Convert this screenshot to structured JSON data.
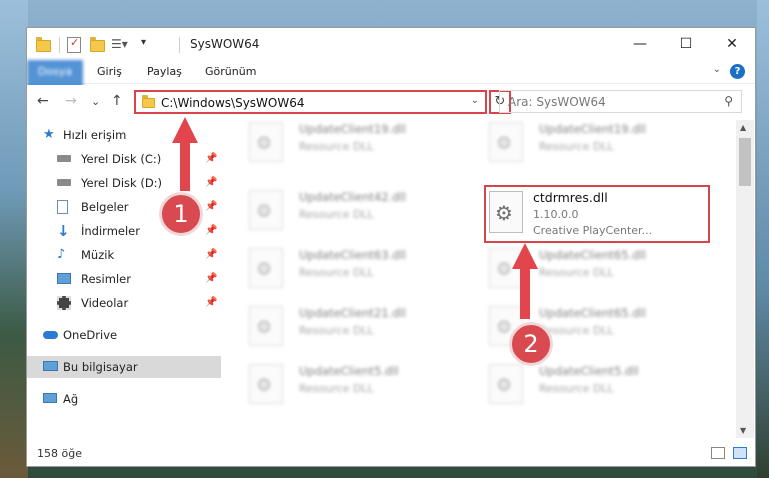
{
  "window": {
    "title": "SysWOW64",
    "minimize": "—",
    "maximize": "☐",
    "close": "✕"
  },
  "ribbon": {
    "tabs": [
      "Dosya",
      "Giriş",
      "Paylaş",
      "Görünüm"
    ],
    "help": "?"
  },
  "navbar": {
    "back": "←",
    "forward": "→",
    "recent": "⌄",
    "up": "↑",
    "address": "C:\\Windows\\SysWOW64",
    "refresh": "↻",
    "search_placeholder": "Ara: SysWOW64"
  },
  "sidebar": {
    "items": [
      {
        "label": "Hızlı erişim",
        "icon": "star-icon"
      },
      {
        "label": "Yerel Disk (C:)",
        "icon": "drive-icon",
        "pinned": true
      },
      {
        "label": "Yerel Disk (D:)",
        "icon": "drive-icon",
        "pinned": true
      },
      {
        "label": "Belgeler",
        "icon": "documents-icon",
        "pinned": true
      },
      {
        "label": "İndirmeler",
        "icon": "download-icon",
        "pinned": true
      },
      {
        "label": "Müzik",
        "icon": "music-icon",
        "pinned": true
      },
      {
        "label": "Resimler",
        "icon": "pictures-icon",
        "pinned": true
      },
      {
        "label": "Videolar",
        "icon": "video-icon",
        "pinned": true
      },
      {
        "label": "OneDrive",
        "icon": "cloud-icon"
      },
      {
        "label": "Bu bilgisayar",
        "icon": "computer-icon",
        "selected": true
      },
      {
        "label": "Ağ",
        "icon": "network-icon"
      }
    ]
  },
  "files": [
    {
      "name": "UpdateClient19.dll",
      "desc": "Resource DLL"
    },
    {
      "name": "UpdateClient19.dll",
      "desc": "Resource DLL"
    },
    {
      "name": "UpdateClient42.dll",
      "desc": "Resource DLL"
    },
    {
      "name": "UpdateClient63.dll",
      "desc": "Resource DLL"
    },
    {
      "name": "UpdateClient65.dll",
      "desc": "Resource DLL"
    },
    {
      "name": "UpdateClient21.dll",
      "desc": "Resource DLL"
    },
    {
      "name": "UpdateClient65.dll",
      "desc": "Resource DLL"
    },
    {
      "name": "UpdateClient5.dll",
      "desc": "Resource DLL"
    },
    {
      "name": "UpdateClient5.dll",
      "desc": "Resource DLL"
    }
  ],
  "highlighted_file": {
    "name": "ctdrmres.dll",
    "version": "1.10.0.0",
    "desc": "Creative PlayCenter..."
  },
  "status": {
    "count": "158 öğe"
  },
  "annotations": {
    "step1": "1",
    "step2": "2"
  },
  "colors": {
    "accent": "#1a6fc9",
    "highlight": "#d9434a",
    "selected": "#d9d9d9"
  }
}
